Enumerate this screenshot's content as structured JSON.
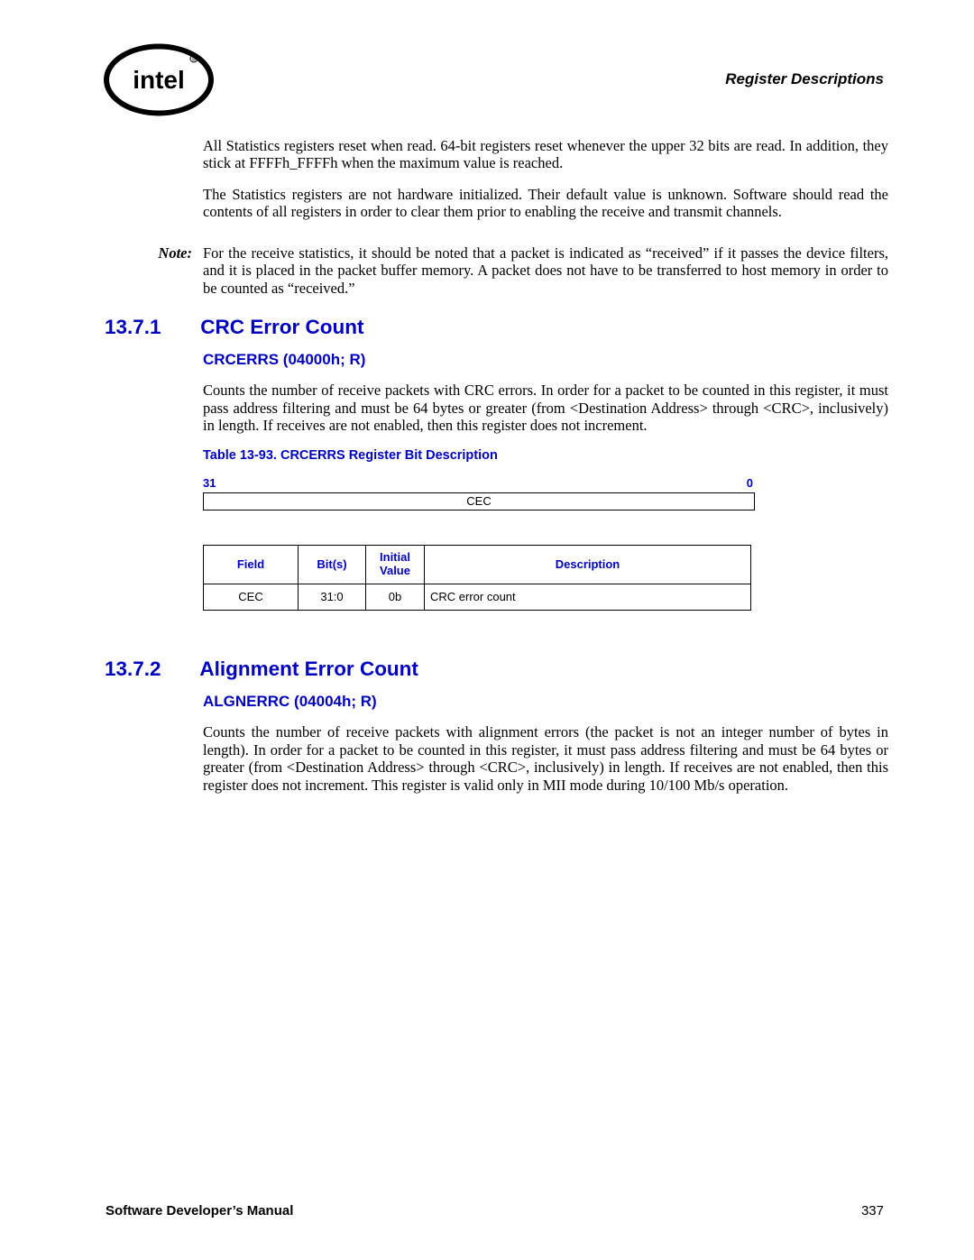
{
  "header": {
    "right_title": "Register Descriptions"
  },
  "intro": {
    "p1": "All Statistics registers reset when read. 64-bit registers reset whenever the upper 32 bits are read. In addition, they stick at FFFFh_FFFFh when the maximum value is reached.",
    "p2": "The Statistics registers are not hardware initialized. Their default value is unknown. Software should read the contents of all registers in order to clear them prior to enabling the receive and transmit channels."
  },
  "note": {
    "label": "Note:",
    "body": "For the receive statistics, it should be noted that a packet is indicated as “received” if it passes the device filters, and it is placed in the packet buffer memory. A packet does not have to be transferred to host memory in order to be counted as “received.”"
  },
  "sections": [
    {
      "num": "13.7.1",
      "title": "CRC Error Count",
      "subtitle": "CRCERRS (04000h; R)",
      "body": "Counts the number of receive packets with CRC errors. In order for a packet to be counted in this register, it must pass address filtering and must be 64 bytes or greater (from <Destination Address> through <CRC>, inclusively) in length. If receives are not enabled, then this register does not increment.",
      "table_caption": "Table 13-93. CRCERRS Register Bit Description",
      "bitfield": {
        "hi": "31",
        "lo": "0",
        "name": "CEC"
      },
      "table": {
        "cols": [
          "Field",
          "Bit(s)",
          "Initial Value",
          "Description"
        ],
        "row": {
          "field": "CEC",
          "bits": "31:0",
          "init": "0b",
          "desc": "CRC error count"
        }
      }
    },
    {
      "num": "13.7.2",
      "title": "Alignment Error Count",
      "subtitle": "ALGNERRC (04004h; R)",
      "body": "Counts the number of receive packets with alignment errors (the packet is not an integer number of bytes in length). In order for a packet to be counted in this register, it must pass address filtering and must be 64 bytes or greater (from <Destination Address> through <CRC>, inclusively) in length. If receives are not enabled, then this register does not increment. This register is valid only in MII mode during 10/100 Mb/s operation."
    }
  ],
  "footer": {
    "title": "Software Developer’s Manual",
    "page": "337"
  }
}
